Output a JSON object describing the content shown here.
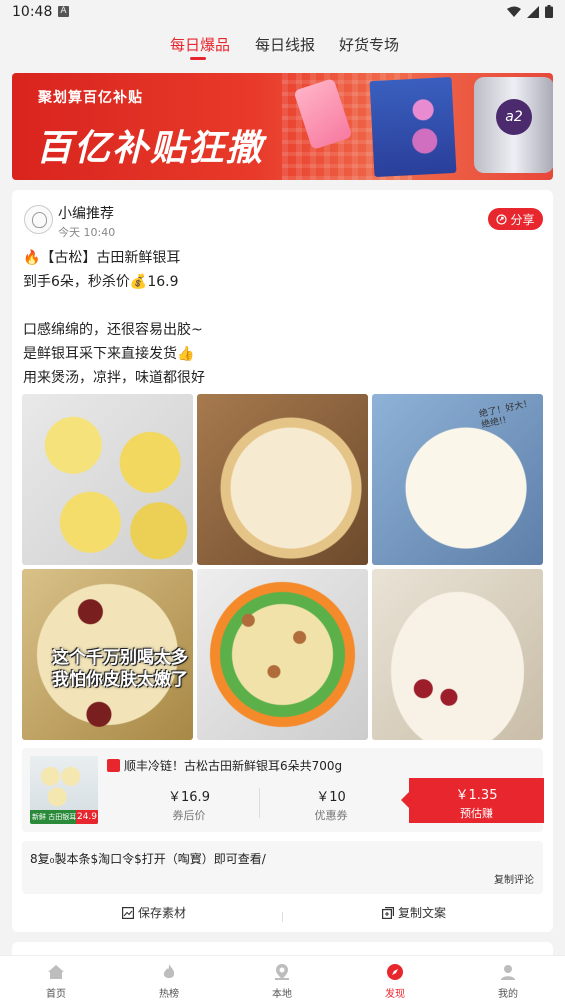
{
  "status_bar": {
    "time": "10:48",
    "badge": "A"
  },
  "top_tabs": [
    {
      "label": "每日爆品",
      "active": true
    },
    {
      "label": "每日线报",
      "active": false
    },
    {
      "label": "好货专场",
      "active": false
    }
  ],
  "banner": {
    "small_text": "聚划算百亿补贴",
    "big_text": "百亿补贴狂撒"
  },
  "post": {
    "author": "小编推荐",
    "time": "今天 10:40",
    "share_label": "分享",
    "lines": [
      "🔥【古松】古田新鲜银耳",
      "到手6朵，秒杀价💰16.9",
      "",
      "口感绵绵的，还很容易出胶~",
      "是鲜银耳采下来直接发货👍",
      "用来煲汤，凉拌，味道都很好"
    ],
    "photo_captions": {
      "photo4": "这个千万别喝太多\n我怕你皮肤太嫩了",
      "photo3": "绝了！好大！绝绝!!"
    }
  },
  "product": {
    "title": "顺丰冷链！古松古田新鲜银耳6朵共700g",
    "thumb_badge": "新鲜 古田银耳 6朵",
    "thumb_price": "24.9",
    "coupon_price": "￥16.9",
    "coupon_price_label": "券后价",
    "coupon_value": "￥10",
    "coupon_value_label": "优惠券",
    "earn_value": "￥1.35",
    "earn_label": "预估赚"
  },
  "tao": {
    "text": "8复₀製本条$淘口令$打开（啕寳）即可查看/",
    "copy_comment": "复制评论"
  },
  "actions": {
    "save": "保存素材",
    "copy": "复制文案"
  },
  "bottom_nav": [
    {
      "label": "首页",
      "icon": "home-icon",
      "active": false
    },
    {
      "label": "热榜",
      "icon": "flame-icon",
      "active": false
    },
    {
      "label": "本地",
      "icon": "location-icon",
      "active": false
    },
    {
      "label": "发现",
      "icon": "compass-icon",
      "active": true
    },
    {
      "label": "我的",
      "icon": "user-icon",
      "active": false
    }
  ],
  "colors": {
    "accent": "#e8262e",
    "background": "#f3f3f3"
  }
}
